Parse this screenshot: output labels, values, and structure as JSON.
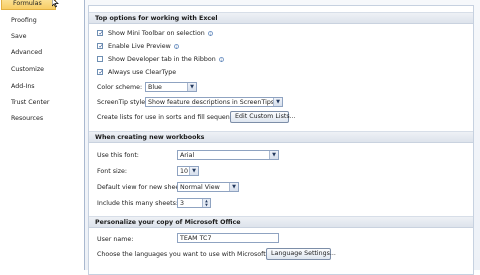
{
  "sidebar": {
    "items": [
      {
        "label": "Formulas"
      },
      {
        "label": "Proofing"
      },
      {
        "label": "Save"
      },
      {
        "label": "Advanced"
      },
      {
        "label": "Customize"
      },
      {
        "label": "Add-Ins"
      },
      {
        "label": "Trust Center"
      },
      {
        "label": "Resources"
      }
    ]
  },
  "section_top": {
    "header": "Top options for working with Excel",
    "mini_toolbar": {
      "label": "Show Mini Toolbar on selection",
      "checked": true
    },
    "live_preview": {
      "label": "Enable Live Preview",
      "checked": true
    },
    "developer_tab": {
      "label": "Show Developer tab in the Ribbon",
      "checked": false
    },
    "cleartype": {
      "label": "Always use ClearType",
      "checked": true
    },
    "color_scheme": {
      "label": "Color scheme:",
      "value": "Blue"
    },
    "screentip": {
      "label": "ScreenTip style:",
      "value": "Show feature descriptions in ScreenTips"
    },
    "custom_lists": {
      "label": "Create lists for use in sorts and fill sequences:",
      "button": "Edit Custom Lists..."
    }
  },
  "section_new": {
    "header": "When creating new workbooks",
    "font": {
      "label": "Use this font:",
      "value": "Arial"
    },
    "font_size": {
      "label": "Font size:",
      "value": "10"
    },
    "default_view": {
      "label": "Default view for new sheets:",
      "value": "Normal View"
    },
    "sheets": {
      "label": "Include this many sheets:",
      "value": "3"
    }
  },
  "section_personalize": {
    "header": "Personalize your copy of Microsoft Office",
    "user_name": {
      "label": "User name:",
      "value": "TEAM TC7"
    },
    "languages": {
      "label": "Choose the languages you want to use with Microsoft Office:",
      "button": "Language Settings..."
    }
  },
  "icons": {
    "info": "info-icon",
    "check": "checkmark-icon",
    "dropdown": "chevron-down-icon",
    "cursor": "mouse-pointer-icon"
  },
  "colors": {
    "selected_bg": "#f8cd64",
    "header_bg": "#dde3ec",
    "border": "#8fa3c1"
  }
}
